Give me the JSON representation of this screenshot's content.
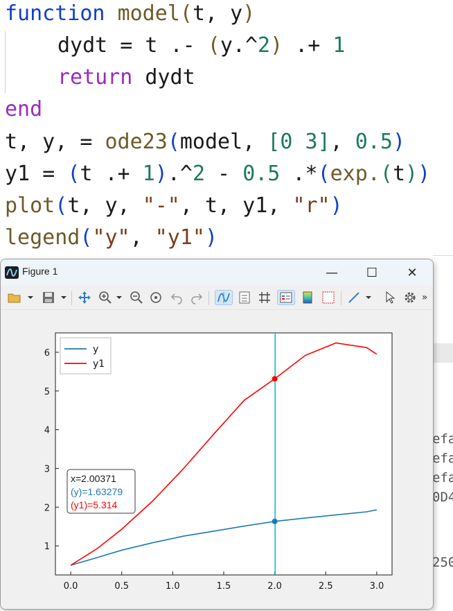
{
  "editor": {
    "line1": {
      "kw": "function",
      "fname": "model",
      "open": "(",
      "args": "t, y",
      "close": ")"
    },
    "line2": {
      "a": "dydt = t .- ",
      "open": "(",
      "b": "y.^",
      "num": "2",
      "close": ")",
      "c": " .+ ",
      "num2": "1"
    },
    "line3": {
      "kw": "return",
      "rest": " dydt"
    },
    "line4": {
      "kw": "end"
    },
    "line5": {
      "a": "t, y, = ",
      "fname": "ode23",
      "open": "(",
      "b": "model, ",
      "br_open": "[",
      "n1": "0",
      "sp": " ",
      "n2": "3",
      "br_close": "]",
      "c": ", ",
      "n3": "0.5",
      "close": ")"
    },
    "line6": {
      "a": "y1 = ",
      "open": "(",
      "b": "t .+ ",
      "n1": "1",
      "close": ")",
      "c": ".^",
      "n2": "2",
      "d": " - ",
      "n3": "0.5",
      "e": " .*",
      "open2": "(",
      "fname": "exp.",
      "open3": "(",
      "f": "t",
      "close3": ")",
      "close2": ")"
    },
    "line7": {
      "fname": "plot",
      "open": "(",
      "a": "t, y, ",
      "s1": "\"-\"",
      "b": ", t, y1, ",
      "s2": "\"r\"",
      "close": ")"
    },
    "line8": {
      "fname": "legend",
      "open": "(",
      "s1": "\"y\"",
      "a": ", ",
      "s2": "\"y1\"",
      "close": ")"
    }
  },
  "repl": {
    "lines": [
      "efa",
      "efa",
      "efa",
      "0D4",
      "250"
    ]
  },
  "figure": {
    "title": "Figure 1",
    "minimize_glyph": "—",
    "maximize_glyph": "☐",
    "close_glyph": "✕",
    "toolbar": {
      "overflow_glyph": "»"
    },
    "datatip": {
      "x_text": "x=2.00371",
      "y_text": "(y)=1.63279",
      "y1_text": "(y1)=5.314",
      "x": 2.00371
    }
  },
  "colors": {
    "series_y": "#1f77b4",
    "series_y1": "#ff0000",
    "cursor_line": "#17becf"
  },
  "chart_data": {
    "type": "line",
    "title": "",
    "xlabel": "",
    "ylabel": "",
    "xlim": [
      -0.15,
      3.15
    ],
    "ylim": [
      0.25,
      6.5
    ],
    "xticks": [
      0.0,
      0.5,
      1.0,
      1.5,
      2.0,
      2.5,
      3.0
    ],
    "xtick_labels": [
      "0.0",
      "0.5",
      "1.0",
      "1.5",
      "2.0",
      "2.5",
      "3.0"
    ],
    "yticks": [
      1,
      2,
      3,
      4,
      5,
      6
    ],
    "ytick_labels": [
      "1",
      "2",
      "3",
      "4",
      "5",
      "6"
    ],
    "legend_position": "top-left",
    "grid": false,
    "series": [
      {
        "name": "y",
        "x": [
          0.0,
          0.26,
          0.5,
          0.8,
          1.1,
          1.4,
          1.7,
          2.0,
          2.3,
          2.6,
          2.9,
          3.0
        ],
        "y": [
          0.5,
          0.7,
          0.89,
          1.08,
          1.25,
          1.38,
          1.51,
          1.633,
          1.72,
          1.8,
          1.88,
          1.93
        ]
      },
      {
        "name": "y1",
        "x": [
          0.0,
          0.26,
          0.5,
          0.8,
          1.1,
          1.4,
          1.7,
          2.0,
          2.3,
          2.6,
          2.9,
          3.0
        ],
        "y": [
          0.5,
          0.93,
          1.43,
          2.15,
          2.98,
          3.88,
          4.76,
          5.314,
          5.92,
          6.24,
          6.12,
          5.95
        ]
      }
    ],
    "markers": [
      {
        "series": "y",
        "x": 2.0,
        "y": 1.633
      },
      {
        "series": "y1",
        "x": 2.0,
        "y": 5.314
      }
    ]
  }
}
